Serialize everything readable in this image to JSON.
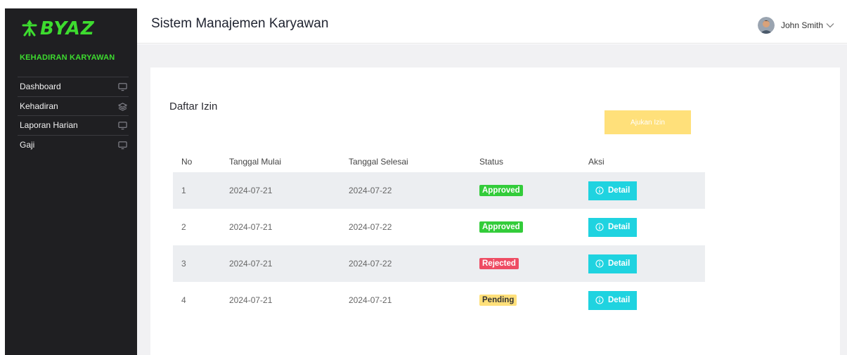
{
  "colors": {
    "accent": "#3ddc2f",
    "sidebar_bg": "#1f1f22",
    "approved": "#33cc3a",
    "rejected": "#ee4c63",
    "pending": "#ffe07a",
    "detail": "#1fd3e0"
  },
  "sidebar": {
    "logo": "BYAZ",
    "section_title": "KEHADIRAN KARYAWAN",
    "items": [
      {
        "label": "Dashboard",
        "icon": "monitor-icon"
      },
      {
        "label": "Kehadiran",
        "icon": "layers-icon"
      },
      {
        "label": "Laporan Harian",
        "icon": "monitor-icon"
      },
      {
        "label": "Gaji",
        "icon": "monitor-icon"
      }
    ]
  },
  "header": {
    "title": "Sistem Manajemen Karyawan",
    "user_name": "John Smith"
  },
  "main": {
    "card_title": "Daftar Izin",
    "ajukan_label": "Ajukan Izin",
    "columns": [
      "No",
      "Tanggal Mulai",
      "Tanggal Selesai",
      "Status",
      "Aksi"
    ],
    "rows": [
      {
        "no": "1",
        "start": "2024-07-21",
        "end": "2024-07-22",
        "status": "Approved",
        "action": "Detail"
      },
      {
        "no": "2",
        "start": "2024-07-21",
        "end": "2024-07-22",
        "status": "Approved",
        "action": "Detail"
      },
      {
        "no": "3",
        "start": "2024-07-21",
        "end": "2024-07-22",
        "status": "Rejected",
        "action": "Detail"
      },
      {
        "no": "4",
        "start": "2024-07-21",
        "end": "2024-07-21",
        "status": "Pending",
        "action": "Detail"
      }
    ]
  }
}
